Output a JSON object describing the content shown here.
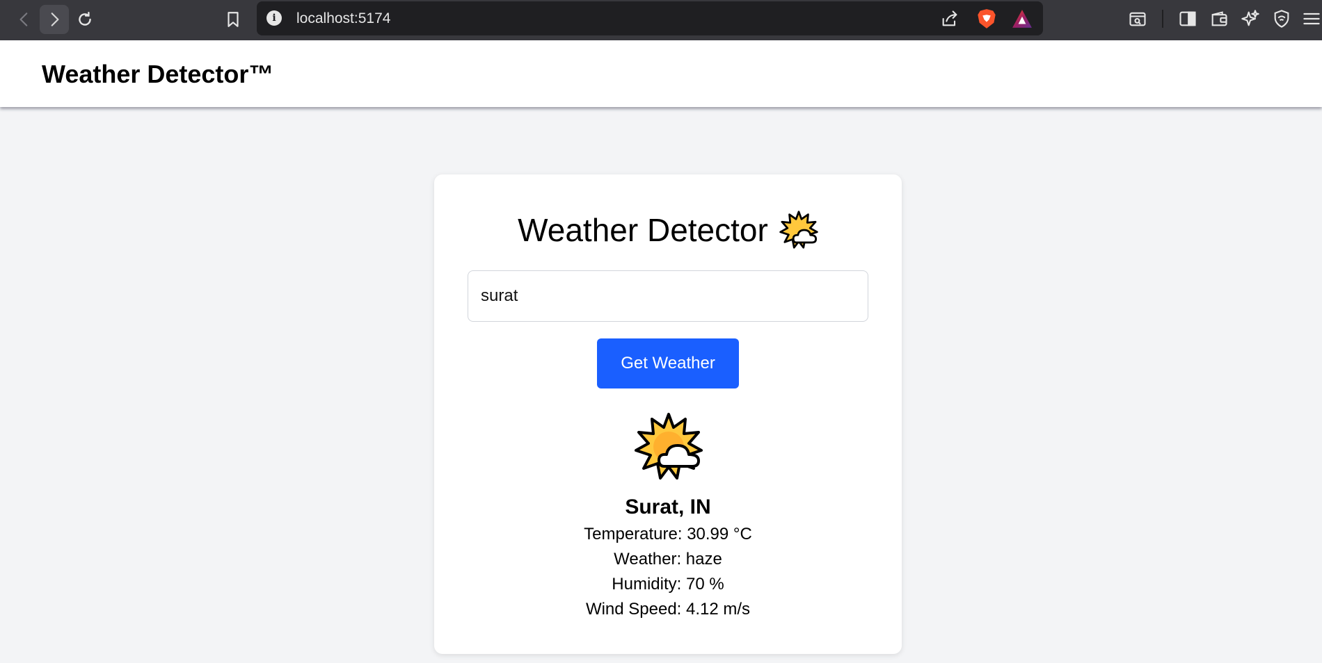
{
  "browser": {
    "url": "localhost:5174",
    "icons": [
      "back-icon",
      "forward-icon",
      "reload-icon",
      "bookmark-icon",
      "info-icon",
      "share-icon",
      "brave-shield-icon",
      "brave-rewards-icon",
      "search-tabs-icon",
      "sidebar-icon",
      "wallet-icon",
      "leo-ai-icon",
      "vpn-icon",
      "menu-icon"
    ],
    "info_glyph": "i"
  },
  "header": {
    "title": "Weather Detector™"
  },
  "card": {
    "title": "Weather Detector",
    "title_icon": "sun-behind-cloud-icon",
    "input_value": "surat",
    "button_label": "Get Weather",
    "weather_icon": "sun-behind-cloud-icon",
    "location": "Surat, IN",
    "temperature": "Temperature: 30.99 °C",
    "weather": "Weather: haze",
    "humidity": "Humidity: 70 %",
    "wind": "Wind Speed: 4.12 m/s"
  },
  "colors": {
    "accent": "#1a5fff",
    "page_bg": "#f3f4f6",
    "chrome_bg": "#38383d"
  }
}
